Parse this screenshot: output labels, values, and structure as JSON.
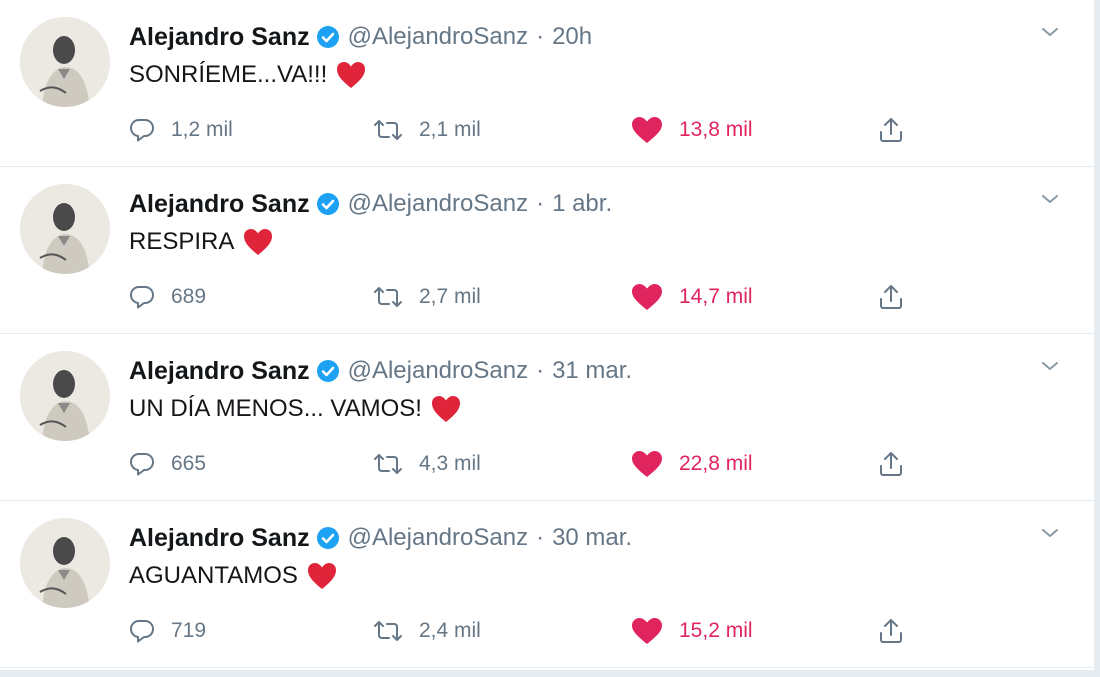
{
  "colors": {
    "name": "#14171a",
    "meta": "#657786",
    "like": "#e0245e",
    "verified": "#1da1f2",
    "divider": "#e6ecf0"
  },
  "icons": {
    "verified": "verified-badge-icon",
    "caret": "chevron-down-icon",
    "reply": "reply-icon",
    "retweet": "retweet-icon",
    "like": "heart-icon",
    "share": "share-icon",
    "emoji": "red-heart-emoji"
  },
  "tweets": [
    {
      "name": "Alejandro Sanz",
      "handle": "@AlejandroSanz",
      "separator": "·",
      "time": "20h",
      "text": "SONRÍEME...VA!!!",
      "replies": "1,2 mil",
      "retweets": "2,1 mil",
      "likes": "13,8 mil"
    },
    {
      "name": "Alejandro Sanz",
      "handle": "@AlejandroSanz",
      "separator": "·",
      "time": "1 abr.",
      "text": "RESPIRA",
      "replies": "689",
      "retweets": "2,7 mil",
      "likes": "14,7 mil"
    },
    {
      "name": "Alejandro Sanz",
      "handle": "@AlejandroSanz",
      "separator": "·",
      "time": "31 mar.",
      "text": "UN DÍA MENOS... VAMOS!",
      "replies": "665",
      "retweets": "4,3 mil",
      "likes": "22,8 mil"
    },
    {
      "name": "Alejandro Sanz",
      "handle": "@AlejandroSanz",
      "separator": "·",
      "time": "30 mar.",
      "text": "AGUANTAMOS",
      "replies": "719",
      "retweets": "2,4 mil",
      "likes": "15,2 mil"
    }
  ]
}
